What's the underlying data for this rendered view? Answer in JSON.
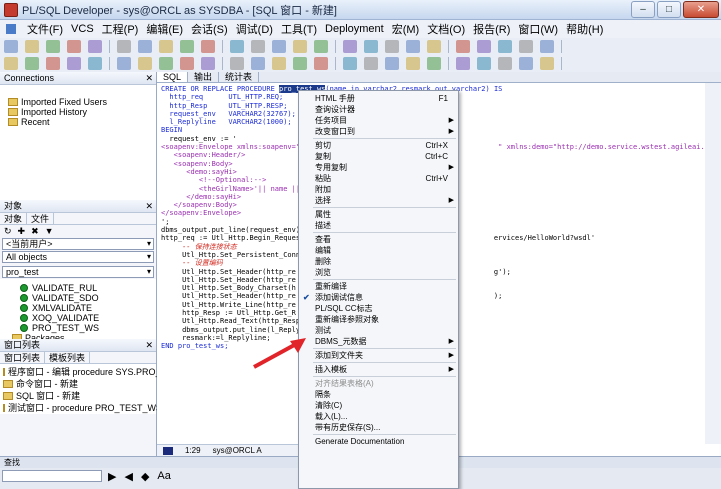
{
  "window": {
    "title": "PL/SQL Developer - sys@ORCL as SYSDBA - [SQL 窗口 - 新建]",
    "min": "–",
    "max": "□",
    "close": "✕"
  },
  "menu": [
    "文件(F)",
    "VCS",
    "工程(P)",
    "编辑(E)",
    "会话(S)",
    "调试(D)",
    "工具(T)",
    "Deployment",
    "宏(M)",
    "文档(O)",
    "报告(R)",
    "窗口(W)",
    "帮助(H)"
  ],
  "connections": {
    "title": "Connections",
    "items": [
      "Imported Fixed Users",
      "Imported History",
      "Recent"
    ]
  },
  "objects": {
    "title": "对象",
    "tabs": [
      "对象",
      "文件"
    ],
    "user_combo": "<当前用户>",
    "filter_combo": "All objects",
    "search_value": "pro_test",
    "rows": [
      "VALIDATE_RUL",
      "VALIDATE_SDO",
      "XMLVALIDATE",
      "XOQ_VALIDATE",
      "PRO_TEST_WS",
      "Packages"
    ]
  },
  "windowlist": {
    "title": "窗口列表",
    "tabs": [
      "窗口列表",
      "模板列表"
    ],
    "items": [
      "程序窗口 - 编辑 procedure SYS.PRO_TE",
      "命令窗口 - 新建",
      "SQL 窗口 - 新建",
      "测试窗口 - procedure PRO_TEST_WS@ORCL"
    ]
  },
  "editor": {
    "tabs": [
      "SQL",
      "输出",
      "统计表"
    ],
    "lines": [
      "CREATE OR REPLACE PROCEDURE pro_test_ws(name in varchar2,resmark out varchar2) IS",
      "  http_req      UTL_HTTP.REQ;",
      "  http_Resp     UTL_HTTP.RESP;",
      "  request_env   VARCHAR2(32767);",
      "  l_Replyline   VARCHAR2(1000);",
      "BEGIN",
      "  request_env := '",
      "<soapenv:Envelope xmlns:soapenv=\"h                                              \" xmlns:demo=\"http://demo.service.wstest.agileai.com/\">",
      "   <soapenv:Header/>",
      "   <soapenv:Body>",
      "      <demo:sayHi>",
      "         <!--Optional:-->",
      "         <theGirlName>'|| name ||'",
      "      </demo:sayHi>",
      "   </soapenv:Body>",
      "</soapenv:Envelope>",
      "';",
      "dbms_output.put_line(request_env)",
      "http_req := Utl_Http.Begin_Request                                             ervices/HelloWorld?wsdl'",
      "",
      "     -- 保持连接状态",
      "     Utl_Http.Set_Persistent_Conn",
      "",
      "     -- 设置编码",
      "     Utl_Http.Set_Header(http_re                                               g');",
      "",
      "     Utl_Http.Set_Header(http_re",
      "",
      "     Utl_Http.Set_Body_Charset(h",
      "",
      "     Utl_Http.Set_Header(http_re                                               );",
      "",
      "     Utl_Http.Write_Line(http_re",
      "",
      "     http_Resp := Utl_Http.Get_R",
      "",
      "     Utl_Http.Read_Text(http_Resp",
      "",
      "     dbms_output.put_line(l_Reply",
      "",
      "     resmark:=l_Replyline;",
      "END pro_test_ws;"
    ]
  },
  "status": {
    "pos": "1:29",
    "conn": "sys@ORCL A"
  },
  "find": {
    "title": "查找"
  },
  "context_menu": [
    {
      "label": "HTML 手册",
      "shortcut": "F1"
    },
    {
      "label": "查询设计器"
    },
    {
      "label": "任务项目",
      "submenu": true
    },
    {
      "label": "改变窗口到",
      "submenu": true
    },
    {
      "sep": true
    },
    {
      "label": "剪切",
      "shortcut": "Ctrl+X"
    },
    {
      "label": "复制",
      "shortcut": "Ctrl+C"
    },
    {
      "label": "专用复制",
      "submenu": true
    },
    {
      "label": "粘贴",
      "shortcut": "Ctrl+V"
    },
    {
      "label": "附加"
    },
    {
      "label": "选择",
      "submenu": true
    },
    {
      "sep": true
    },
    {
      "label": "属性"
    },
    {
      "label": "描述"
    },
    {
      "sep": true
    },
    {
      "label": "查看"
    },
    {
      "label": "编辑"
    },
    {
      "label": "删除"
    },
    {
      "label": "浏览"
    },
    {
      "sep": true
    },
    {
      "label": "重新编译"
    },
    {
      "label": "添加调试信息",
      "checked": true
    },
    {
      "label": "PL/SQL CC标志"
    },
    {
      "label": "重新编译参照对象"
    },
    {
      "label": "测试"
    },
    {
      "label": "DBMS_元数据",
      "submenu": true
    },
    {
      "sep": true
    },
    {
      "label": "添加到文件夹",
      "submenu": true
    },
    {
      "sep": true
    },
    {
      "label": "插入模板",
      "submenu": true
    },
    {
      "sep": true
    },
    {
      "label": "对齐结果表格(A)",
      "disabled": true
    },
    {
      "label": "隔条"
    },
    {
      "label": "清除(C)"
    },
    {
      "label": "载入(L)..."
    },
    {
      "label": "带有历史保存(S)..."
    },
    {
      "sep": true
    },
    {
      "label": "Generate Documentation"
    }
  ],
  "colors": {
    "accent": "#1c3a8c",
    "keyword": "#1c2cd6",
    "comment": "#2a8b1d",
    "arrow": "#e0242a"
  }
}
